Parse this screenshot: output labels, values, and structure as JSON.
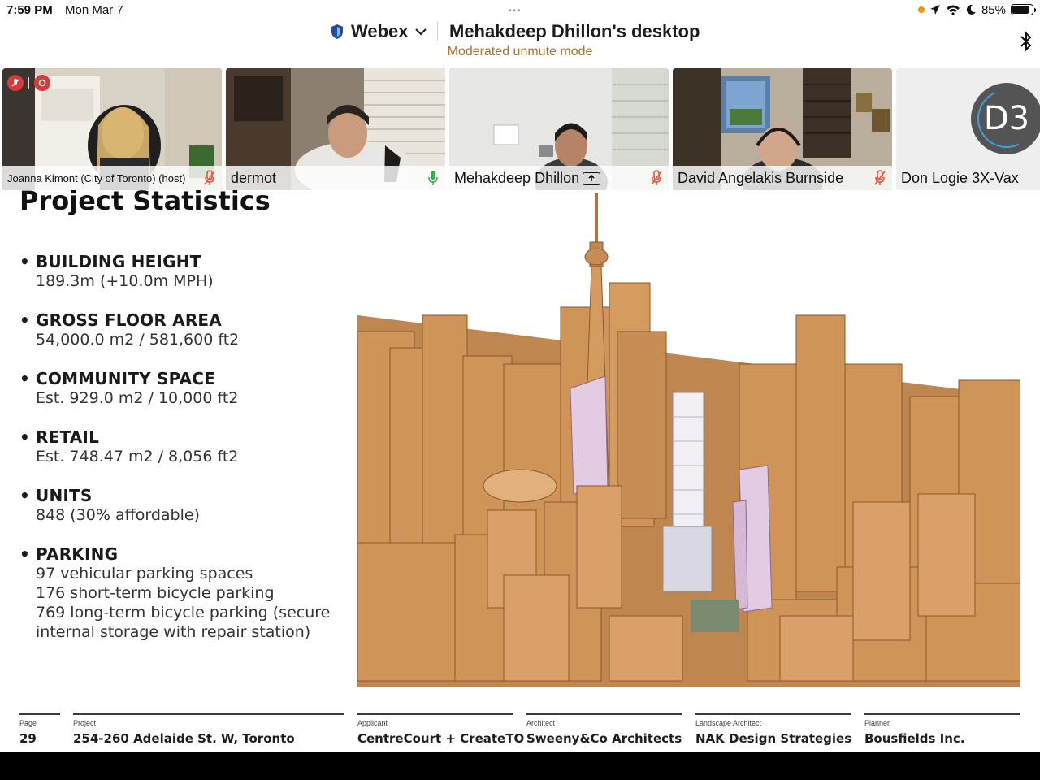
{
  "status_bar": {
    "time": "7:59 PM",
    "date": "Mon Mar 7",
    "more_dots": "•••",
    "battery_percent": "85%",
    "battery_level": 0.85
  },
  "header": {
    "app_name": "Webex",
    "share_title": "Mehakdeep Dhillon's desktop",
    "mode": "Moderated unmute mode"
  },
  "participants": [
    {
      "name": "Joanna Kimont (City of Toronto) (host)",
      "mic": "muted",
      "mic_color": "#e6533c"
    },
    {
      "name": "dermot",
      "mic": "active",
      "mic_color": "#2fb34a"
    },
    {
      "name": "Mehakdeep Dhillon",
      "mic": "muted",
      "mic_color": "#e6533c",
      "sharing": true
    },
    {
      "name": "David Angelakis Burnside",
      "mic": "muted",
      "mic_color": "#e6533c"
    },
    {
      "name": "Don Logie 3X-Vax",
      "initials": "D3"
    }
  ],
  "slide": {
    "title": "Project Statistics",
    "stats": [
      {
        "heading": "BUILDING HEIGHT",
        "lines": [
          "189.3m (+10.0m MPH)"
        ]
      },
      {
        "heading": "GROSS FLOOR AREA",
        "lines": [
          "54,000.0 m2 / 581,600 ft2"
        ]
      },
      {
        "heading": "COMMUNITY SPACE",
        "lines": [
          "Est. 929.0 m2 / 10,000 ft2"
        ]
      },
      {
        "heading": "RETAIL",
        "lines": [
          "Est. 748.47 m2 / 8,056 ft2"
        ]
      },
      {
        "heading": "UNITS",
        "lines": [
          "848 (30% affordable)"
        ]
      },
      {
        "heading": "PARKING",
        "lines": [
          "97 vehicular parking spaces",
          "176 short-term bicycle parking",
          "769 long-term bicycle parking (secure",
          "internal storage with repair station)"
        ]
      }
    ],
    "footer": {
      "page_label": "Page",
      "page_value": "29",
      "project_label": "Project",
      "project_value": "254-260 Adelaide St. W, Toronto",
      "applicant_label": "Applicant",
      "applicant_value": "CentreCourt + CreateTO",
      "architect_label": "Architect",
      "architect_value": "Sweeny&Co Architects",
      "landscape_label": "Landscape Architect",
      "landscape_value": "NAK Design Strategies",
      "planner_label": "Planner",
      "planner_value": "Bousfields Inc."
    }
  },
  "colors": {
    "accent_webex": "#1a4fa0",
    "unmute_mode_text": "#b5702a",
    "muted_mic": "#e6533c",
    "active_mic": "#2fb34a",
    "building_tone": "#c98a4e",
    "proposed_tower": "#e3cbe3"
  },
  "icons": [
    "shield-icon",
    "chevron-down-icon",
    "bluetooth-icon",
    "mic-muted-icon",
    "mic-active-icon",
    "share-screen-icon",
    "location-icon",
    "wifi-icon",
    "moon-icon",
    "battery-icon"
  ]
}
